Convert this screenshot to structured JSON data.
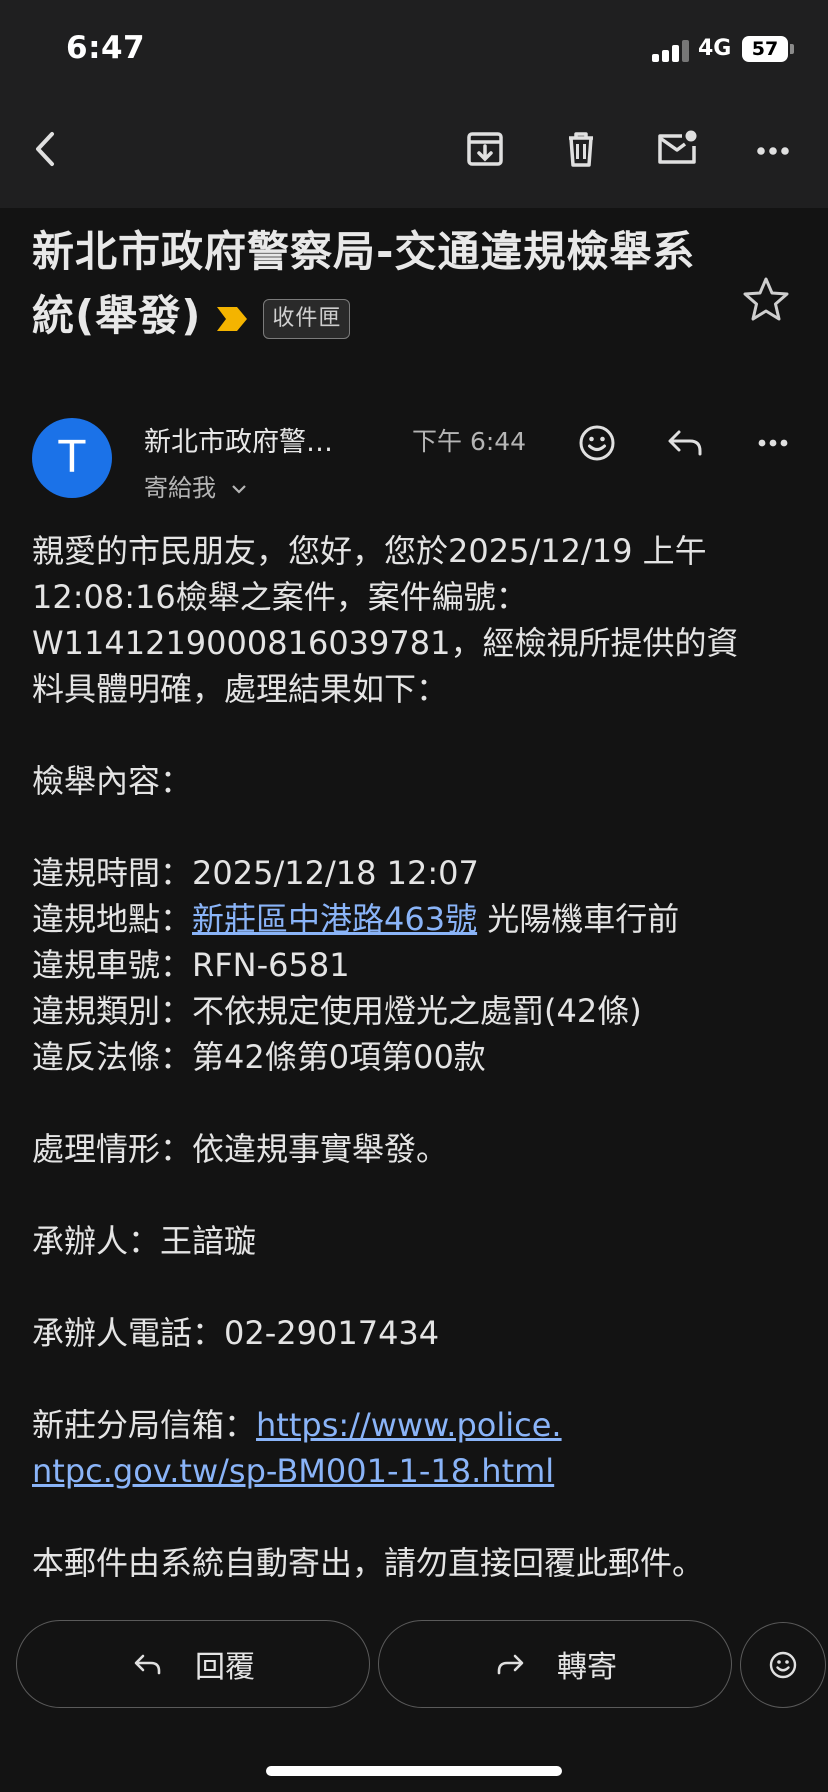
{
  "status_bar": {
    "time": "6:47",
    "network": "4G",
    "battery": "57"
  },
  "toolbar": {
    "icons": [
      "back-arrow-icon",
      "archive-icon",
      "trash-icon",
      "mark-unread-icon",
      "more-icon"
    ]
  },
  "email": {
    "subject": "新北市政府警察局-交通違規檢舉系統(舉發)",
    "label": "收件匣",
    "sender_initial": "T",
    "sender_name": "新北市政府警…",
    "time": "下午 6:44",
    "recipient": "寄給我",
    "body": {
      "intro_1": "親愛的市民朋友，您好，您於2025/12/19 上午",
      "intro_2": "12:08:16檢舉之案件，案件編號：",
      "intro_3": "W1141219000816039781，經檢視所提供的資",
      "intro_4": "料具體明確，處理結果如下：",
      "content_heading": "檢舉內容：",
      "time_line": "違規時間：2025/12/18 12:07",
      "location_label": "違規地點：",
      "location_link": "新莊區中港路463號",
      "location_suffix": " 光陽機車行前",
      "plate_line": "違規車號：RFN-6581",
      "category_line": "違規類別：不依規定使用燈光之處罰(42條)",
      "law_line": "違反法條：第42條第0項第00款",
      "handling_line": "處理情形：依違規事實舉發。",
      "officer_line": "承辦人：王諳璇",
      "phone_line": "承辦人電話：02-29017434",
      "mailbox_label": "新莊分局信箱：",
      "mailbox_link_1": "https://www.police.",
      "mailbox_link_2": "ntpc.gov.tw/sp-BM001-1-18.html",
      "footer_note": "本郵件由系統自動寄出，請勿直接回覆此郵件。"
    }
  },
  "actions": {
    "reply": "回覆",
    "forward": "轉寄"
  },
  "colors": {
    "avatar": "#1b72e8",
    "link": "#8ab4f8",
    "importance": "#f4b400",
    "background": "#131313"
  }
}
